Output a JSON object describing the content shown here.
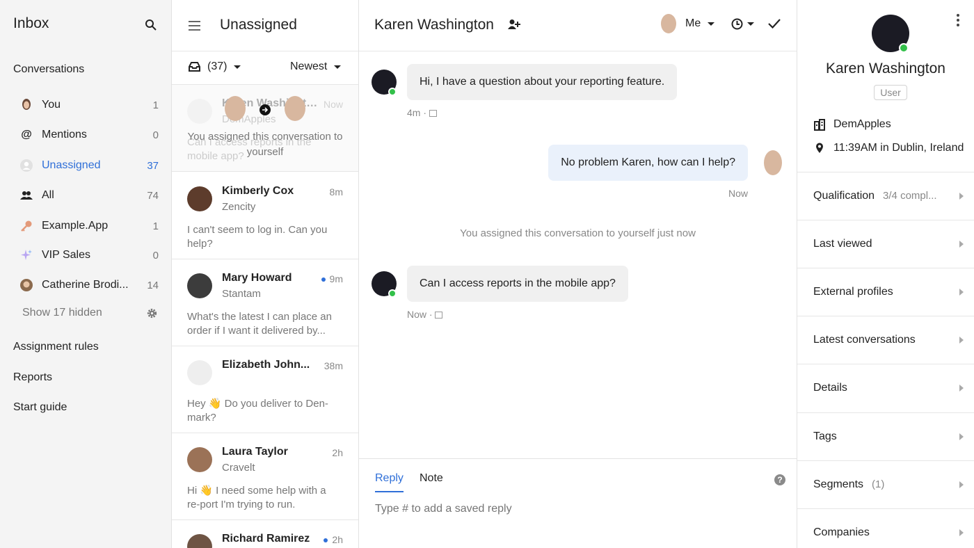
{
  "nav": {
    "title": "Inbox",
    "sections": {
      "conversations": "Conversations",
      "assignment_rules": "Assignment rules",
      "reports": "Reports",
      "start_guide": "Start guide"
    },
    "items": [
      {
        "label": "You",
        "count": "1"
      },
      {
        "label": "Mentions",
        "count": "0"
      },
      {
        "label": "Unassigned",
        "count": "37"
      },
      {
        "label": "All",
        "count": "74"
      },
      {
        "label": "Example.App",
        "count": "1"
      },
      {
        "label": "VIP Sales",
        "count": "0"
      },
      {
        "label": "Catherine Brodi...",
        "count": "14"
      }
    ],
    "show_hidden": "Show 17 hidden"
  },
  "list": {
    "title": "Unassigned",
    "filter_count": "(37)",
    "sort": "Newest",
    "first": {
      "ghost_name": "Karen Washington",
      "ghost_org": "DemApples",
      "ghost_time": "Now",
      "ghost_msg": "Can I access reports in the mobile app?",
      "overlay_text": "You assigned this conversation to yourself"
    },
    "conversations": [
      {
        "name": "Kimberly Cox",
        "time": "8m",
        "org": "Zencity",
        "msg": "I can't seem to log in. Can you help?"
      },
      {
        "name": "Mary Howard",
        "time": "9m",
        "org": "Stantam",
        "msg": "What's the latest I can place an order if I want it delivered by..."
      },
      {
        "name": "Elizabeth John...",
        "time": "38m",
        "org": "",
        "msg": "Hey 👋 Do you deliver to Den-mark?"
      },
      {
        "name": "Laura Taylor",
        "time": "2h",
        "org": "Cravelt",
        "msg": "Hi 👋 I need some help with a re-port I'm trying to run."
      },
      {
        "name": "Richard Ramirez",
        "time": "2h",
        "org": "",
        "msg": ""
      }
    ]
  },
  "conversation": {
    "name": "Karen Washington",
    "assignee": "Me",
    "messages": [
      {
        "text": "Hi, I have a question about your reporting feature.",
        "meta": "4m ·"
      },
      {
        "text": "No problem Karen, how can I help?",
        "meta": "Now"
      },
      {
        "text": "Can I access reports in the mobile app?",
        "meta": "Now ·"
      }
    ],
    "system": "You assigned this conversation to yourself just now",
    "reply_tab": "Reply",
    "note_tab": "Note",
    "reply_placeholder": "Type # to add a saved reply"
  },
  "profile": {
    "name": "Karen Washington",
    "role": "User",
    "company": "DemApples",
    "location": "11:39AM in Dublin, Ireland",
    "sections": [
      {
        "label": "Qualification",
        "sub": "3/4 compl..."
      },
      {
        "label": "Last viewed",
        "sub": ""
      },
      {
        "label": "External profiles",
        "sub": ""
      },
      {
        "label": "Latest conversations",
        "sub": ""
      },
      {
        "label": "Details",
        "sub": ""
      },
      {
        "label": "Tags",
        "sub": ""
      },
      {
        "label": "Segments",
        "sub": "(1)"
      },
      {
        "label": "Companies",
        "sub": ""
      }
    ]
  },
  "colors": {
    "accent": "#2f6fd8",
    "online": "#33c04a"
  }
}
